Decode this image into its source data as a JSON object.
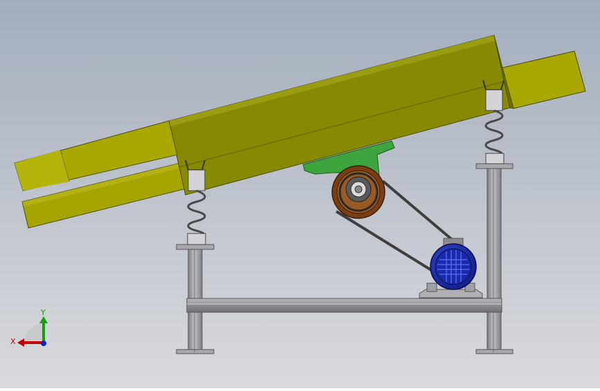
{
  "triad": {
    "x_label": "X",
    "y_label": "Y",
    "colors": {
      "x": "#c00000",
      "y": "#10a010",
      "z": "#1020c0"
    }
  },
  "colors": {
    "bg_top": "#a6afbe",
    "bg_bottom": "#d6d7da",
    "trough": "#878a00",
    "trough_light": "#a9a800",
    "trough_dark": "#6f7200",
    "frame": "#9a9a9e",
    "pulley_mount": "#3a9a3a",
    "pulley": "#8a4a1c",
    "motor": "#1c2fb8",
    "belt": "#4a4a4a",
    "spring": "#555555"
  }
}
